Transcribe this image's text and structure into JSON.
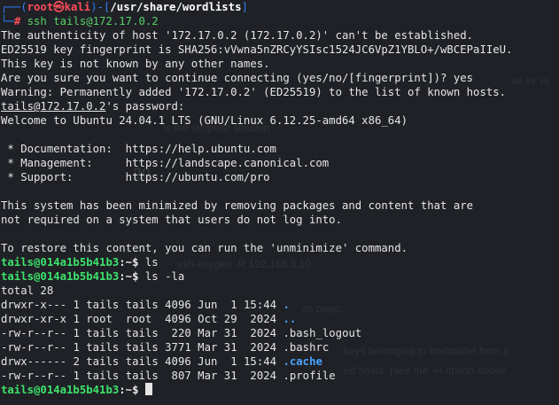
{
  "kali_prompt": {
    "user": "root",
    "symbol": "㉿",
    "host": "kali",
    "path": "/usr/share/wordlists",
    "hash": "#",
    "command": "ssh tails@172.17.0.2"
  },
  "ssh_output": [
    "The authenticity of host '172.17.0.2 (172.17.0.2)' can't be established.",
    "ED25519 key fingerprint is SHA256:vVwna5nZRCyYSIsc1524JC6VpZ1YBLO+/wBCEPaIIeU.",
    "This key is not known by any other names.",
    "Are you sure you want to continue connecting (yes/no/[fingerprint])? yes",
    "Warning: Permanently added '172.17.0.2' (ED25519) to the list of known hosts."
  ],
  "password_prompt": {
    "user_host": "tails@172.17.0.2",
    "rest": "'s password:"
  },
  "welcome": "Welcome to Ubuntu 24.04.1 LTS (GNU/Linux 6.12.25-amd64 x86_64)",
  "links": [
    {
      "label": " * Documentation:",
      "url": "https://help.ubuntu.com"
    },
    {
      "label": " * Management:",
      "url": "https://landscape.canonical.com"
    },
    {
      "label": " * Support:",
      "url": "https://ubuntu.com/pro"
    }
  ],
  "minimized": [
    "This system has been minimized by removing packages and content that are",
    "not required on a system that users do not log into."
  ],
  "restore": "To restore this content, you can run the 'unminimize' command.",
  "remote_prompt": {
    "user_host": "tails@014a1b5b41b3",
    "sep": ":~$ "
  },
  "commands": [
    "ls",
    "ls -la"
  ],
  "ls_total": "total 28",
  "ls_rows": [
    {
      "perms": "drwxr-x---",
      "links": "1",
      "owner": "tails",
      "group": "tails",
      "size": "4096",
      "month": "Jun",
      "day": " 1",
      "time": "15:44",
      "name": ".",
      "type": "dir"
    },
    {
      "perms": "drwxr-xr-x",
      "links": "1",
      "owner": "root ",
      "group": "root ",
      "size": "4096",
      "month": "Oct",
      "day": "29",
      "time": " 2024",
      "name": "..",
      "type": "dir"
    },
    {
      "perms": "-rw-r--r--",
      "links": "1",
      "owner": "tails",
      "group": "tails",
      "size": " 220",
      "month": "Mar",
      "day": "31",
      "time": " 2024",
      "name": ".bash_logout",
      "type": "file"
    },
    {
      "perms": "-rw-r--r--",
      "links": "1",
      "owner": "tails",
      "group": "tails",
      "size": "3771",
      "month": "Mar",
      "day": "31",
      "time": " 2024",
      "name": ".bashrc",
      "type": "file"
    },
    {
      "perms": "drwx------",
      "links": "2",
      "owner": "tails",
      "group": "tails",
      "size": "4096",
      "month": "Jun",
      "day": " 1",
      "time": "15:44",
      "name": ".cache",
      "type": "dir"
    },
    {
      "perms": "-rw-r--r--",
      "links": "1",
      "owner": "tails",
      "group": "tails",
      "size": " 807",
      "month": "Mar",
      "day": "31",
      "time": " 2024",
      "name": ".profile",
      "type": "file"
    }
  ]
}
